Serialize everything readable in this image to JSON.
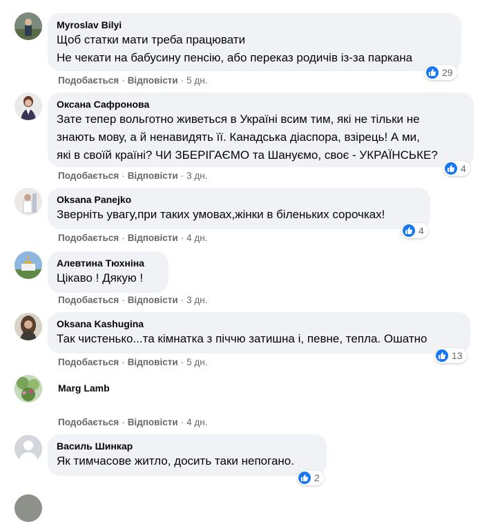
{
  "ui": {
    "like_label": "Подобається",
    "reply_label": "Відповісти",
    "separator": "·",
    "like_color": "#1877f2",
    "bubble_color": "#f0f2f5"
  },
  "comments": [
    {
      "author": "Myroslav Bilyi",
      "lines": [
        "Щоб статки мати треба працювати",
        "Не чекати на бабусину пенсію, або переказ родичів із-за паркана"
      ],
      "time": "5 дн.",
      "reactions": "29"
    },
    {
      "author": "Оксана Сафронова",
      "lines": [
        "Зате тепер вольготно живеться в Україні всим тим, які не тільки не",
        "знають мову, а й ненавидять її. Канадська діаспора, взірець! А ми,",
        "які в своїй країні? ЧИ ЗБЕРІГАЄМО та Шануємо, своє - УКРАЇНСЬКЕ?"
      ],
      "time": "3 дн.",
      "reactions": "4"
    },
    {
      "author": "Oksana Panejko",
      "lines": [
        "Зверніть увагу,при таких умовах,жінки в біленьких сорочках!"
      ],
      "time": "4 дн.",
      "reactions": "4"
    },
    {
      "author": "Алевтина Тюхніна",
      "lines": [
        "Цікаво ! Дякую !"
      ],
      "time": "3 дн.",
      "reactions": ""
    },
    {
      "author": "Oksana Kashugina",
      "lines": [
        "Так чистенько...та кімнатка з піччю затишна і, певне, тепла. Ошатно"
      ],
      "time": "5 дн.",
      "reactions": "13"
    },
    {
      "author": "Marg Lamb",
      "lines": [],
      "time": "4 дн.",
      "reactions": ""
    },
    {
      "author": "Василь Шинкар",
      "lines": [
        "Як тимчасове житло, досить таки непогано."
      ],
      "time": "4 дн.",
      "reactions": "2"
    }
  ]
}
